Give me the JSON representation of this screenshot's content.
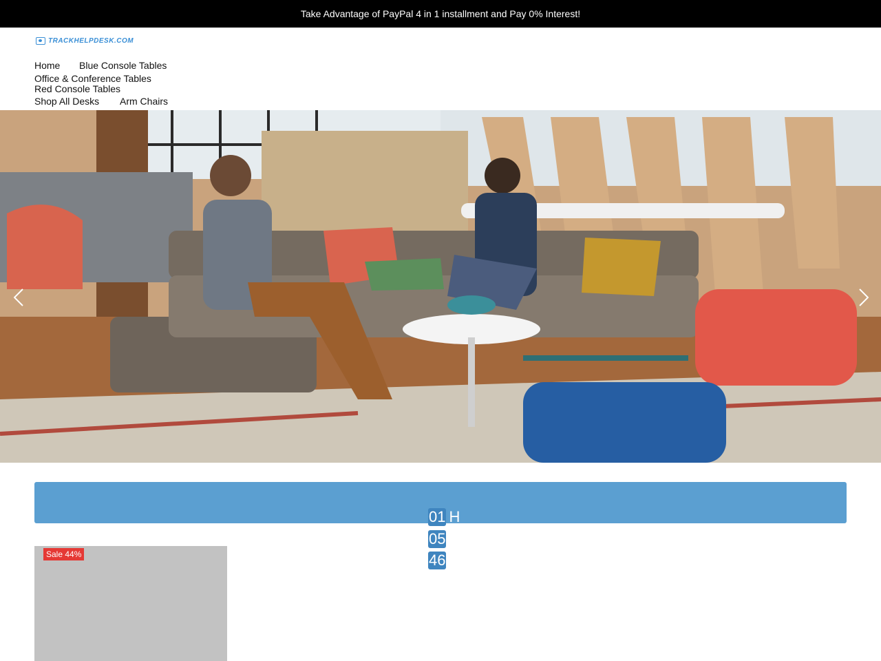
{
  "announcement": {
    "text": "Take Advantage of PayPal 4 in 1 installment and Pay 0% Interest!"
  },
  "logo": {
    "text": "TRACKHELPDESK.COM",
    "icon": "monitor-icon"
  },
  "nav": {
    "items": [
      {
        "label": "Home"
      },
      {
        "label": "Blue Console Tables"
      },
      {
        "label": "Office & Conference Tables"
      },
      {
        "label": "Red Console Tables"
      },
      {
        "label": "Shop All Desks"
      },
      {
        "label": "Arm Chairs"
      }
    ]
  },
  "hero": {
    "prev_icon": "chevron-left-icon",
    "next_icon": "chevron-right-icon"
  },
  "deal": {
    "timer": [
      {
        "value": "01",
        "unit": "H"
      },
      {
        "value": "05",
        "unit": ""
      },
      {
        "value": "46",
        "unit": ""
      }
    ]
  },
  "products": [
    {
      "badge": "Sale 44%"
    }
  ],
  "colors": {
    "accent": "#5b9fd1",
    "timer_box": "#3f85bf",
    "sale": "#e53935",
    "topbar": "#000000"
  }
}
